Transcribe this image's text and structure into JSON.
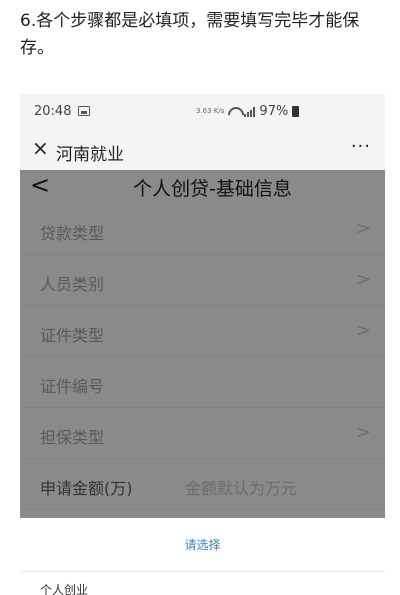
{
  "caption": "6.各个步骤都是必填项，需要填写完毕才能保存。",
  "status_bar": {
    "time": "20:48",
    "network": "3.63 K/s",
    "battery": "97%"
  },
  "app_bar": {
    "title": "河南就业",
    "close_icon": "×",
    "more_icon": "···"
  },
  "page": {
    "back_icon": "<",
    "title": "个人创贷-基础信息",
    "rows": [
      {
        "label": "贷款类型",
        "chevron": ">"
      },
      {
        "label": "人员类别",
        "chevron": ">"
      },
      {
        "label": "证件类型",
        "chevron": ">"
      },
      {
        "label": "证件编号"
      },
      {
        "label": "担保类型",
        "chevron": ">"
      },
      {
        "label": "申请金额(万)",
        "placeholder": "金额默认为万元"
      }
    ]
  },
  "picker": {
    "title": "请选择",
    "options": [
      "个人创业"
    ]
  },
  "colors": {
    "overlay": "#8a8a8a",
    "accent": "#3b82c4"
  }
}
